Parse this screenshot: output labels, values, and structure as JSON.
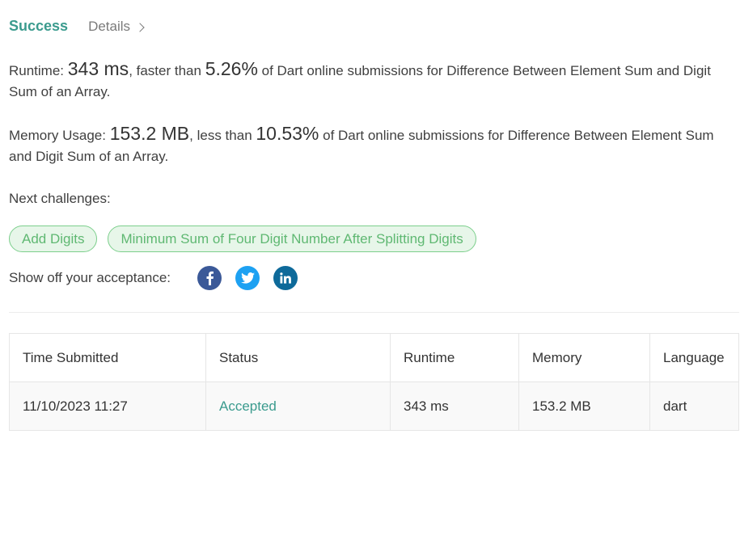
{
  "tabs": {
    "success": "Success",
    "details": "Details"
  },
  "runtime": {
    "label": "Runtime: ",
    "value": "343 ms",
    "mid": ", faster than ",
    "percent": "5.26%",
    "suffix": " of Dart online submissions for Difference Between Element Sum and Digit Sum of an Array."
  },
  "memory": {
    "label": "Memory Usage: ",
    "value": "153.2 MB",
    "mid": ", less than ",
    "percent": "10.53%",
    "suffix": " of Dart online submissions for Difference Between Element Sum and Digit Sum of an Array."
  },
  "next": {
    "label": "Next challenges:",
    "items": [
      "Add Digits",
      "Minimum Sum of Four Digit Number After Splitting Digits"
    ]
  },
  "share": {
    "label": "Show off your acceptance:",
    "icons": [
      "facebook-icon",
      "twitter-icon",
      "linkedin-icon"
    ]
  },
  "table": {
    "headers": [
      "Time Submitted",
      "Status",
      "Runtime",
      "Memory",
      "Language"
    ],
    "rows": [
      [
        "11/10/2023 11:27",
        "Accepted",
        "343 ms",
        "153.2 MB",
        "dart"
      ]
    ]
  },
  "colors": {
    "accent": "#3b9b8e",
    "chip_bg": "#e7f6e9",
    "chip_border": "#7ccf8c",
    "chip_text": "#5fb872"
  }
}
